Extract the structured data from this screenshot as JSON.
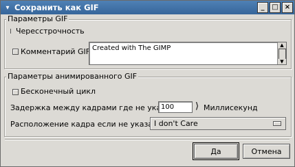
{
  "window": {
    "title": "Сохранить как GIF",
    "menu_glyph": "▾",
    "minimize_glyph": "_",
    "maximize_glyph": "□",
    "close_glyph": "×"
  },
  "gif_options": {
    "frame_label": "Параметры GIF",
    "interlace_label": "Чересстрочность",
    "comment_label": "Комментарий GIF:",
    "comment_value": "Created with The GIMP"
  },
  "animation_options": {
    "frame_label": "Параметры анимированного GIF",
    "loop_label": "Бесконечный цикл",
    "delay_label": "Задержка между кадрами где не указано:",
    "delay_value": "100",
    "delay_unit": "Миллисекунд",
    "disposal_label": "Расположение кадра если не указано:",
    "disposal_value": "I don't Care"
  },
  "buttons": {
    "ok": "Да",
    "cancel": "Отмена"
  },
  "icons": {
    "window_menu": "window-menu-icon",
    "spin_arrows": "spin-arrows-icon",
    "combo_indicator": "combo-indicator-icon"
  }
}
